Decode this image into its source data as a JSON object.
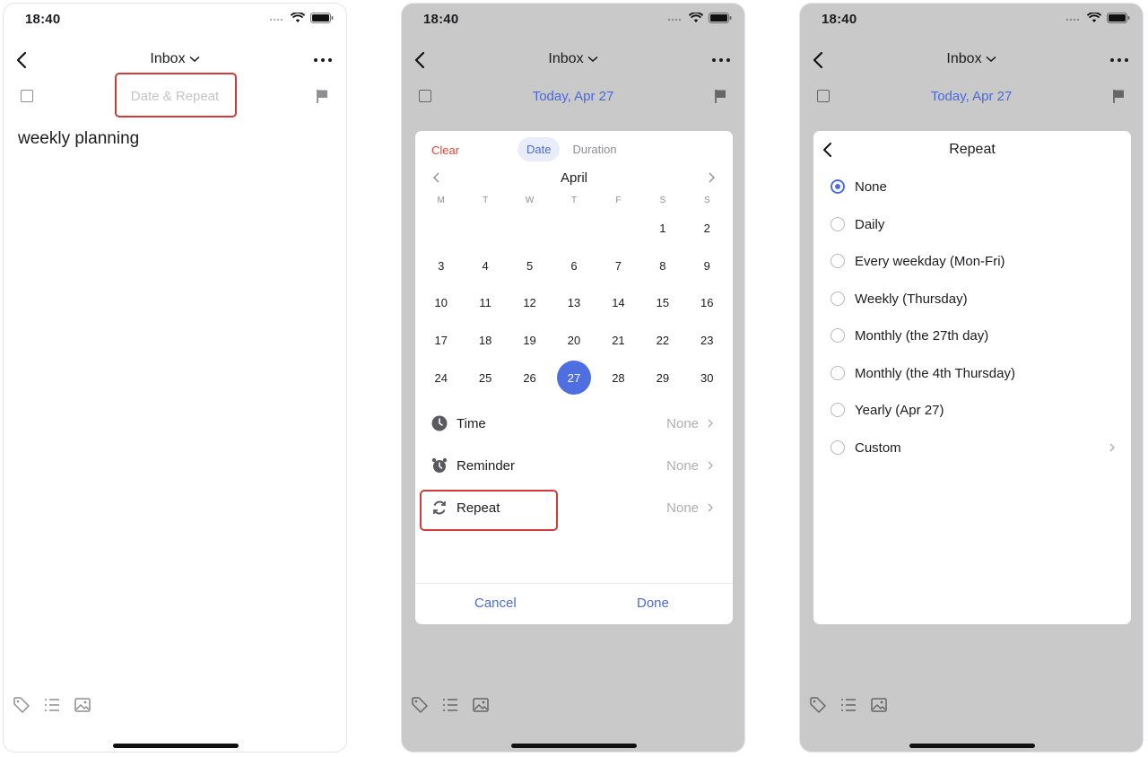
{
  "status": {
    "time": "18:40"
  },
  "screen1": {
    "nav_title": "Inbox",
    "date_label": "Date & Repeat",
    "task_title": "weekly planning"
  },
  "screen2": {
    "nav_title": "Inbox",
    "date_label": "Today, Apr 27",
    "clear": "Clear",
    "tabs": [
      "Date",
      "Duration"
    ],
    "month": "April",
    "weekdays": [
      "M",
      "T",
      "W",
      "T",
      "F",
      "S",
      "S"
    ],
    "days": [
      [
        "",
        "",
        "",
        "",
        "",
        "1",
        "2"
      ],
      [
        "3",
        "4",
        "5",
        "6",
        "7",
        "8",
        "9"
      ],
      [
        "10",
        "11",
        "12",
        "13",
        "14",
        "15",
        "16"
      ],
      [
        "17",
        "18",
        "19",
        "20",
        "21",
        "22",
        "23"
      ],
      [
        "24",
        "25",
        "26",
        "27",
        "28",
        "29",
        "30"
      ]
    ],
    "selected_day": "27",
    "options": [
      {
        "label": "Time",
        "value": "None"
      },
      {
        "label": "Reminder",
        "value": "None"
      },
      {
        "label": "Repeat",
        "value": "None"
      }
    ],
    "cancel": "Cancel",
    "done": "Done"
  },
  "screen3": {
    "nav_title": "Inbox",
    "date_label": "Today, Apr 27",
    "title": "Repeat",
    "options": [
      "None",
      "Daily",
      "Every weekday (Mon-Fri)",
      "Weekly (Thursday)",
      "Monthly (the 27th day)",
      "Monthly (the 4th Thursday)",
      "Yearly (Apr 27)",
      "Custom"
    ],
    "selected": "None"
  },
  "colors": {
    "accent": "#4f6fe0",
    "highlight": "#d03a3a",
    "clear": "#e0453a"
  }
}
